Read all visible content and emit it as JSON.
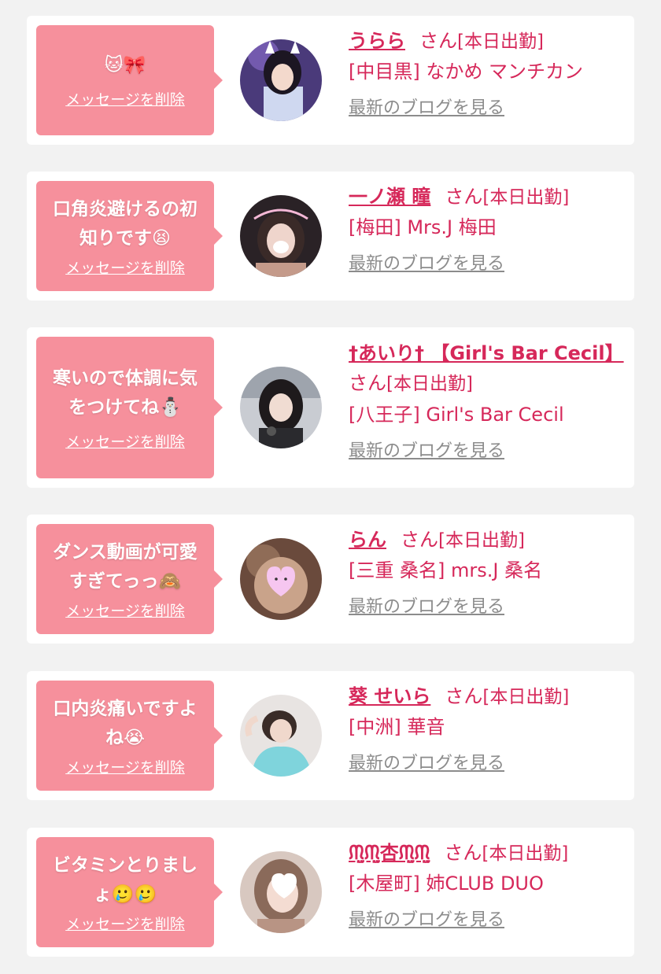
{
  "colors": {
    "accent": "#d6285a",
    "bubble": "#f6909c",
    "link_gray": "#8c8c8c",
    "background": "#f2f2f2"
  },
  "entries": [
    {
      "message": "🐱🎀",
      "delete_label": "メッセージを削除",
      "name": "うらら",
      "honorific": "さん",
      "status": "[本日出勤]",
      "shop": "[中目黒] なかめ マンチカン",
      "blog_link": "最新のブログを見る"
    },
    {
      "message": "口角炎避けるの初知りです😫",
      "delete_label": "メッセージを削除",
      "name": "一ノ瀬 瞳",
      "honorific": "さん",
      "status": "[本日出勤]",
      "shop": "[梅田] Mrs.J 梅田",
      "blog_link": "最新のブログを見る"
    },
    {
      "message": "寒いので体調に気をつけてね⛄",
      "delete_label": "メッセージを削除",
      "name": "†あいり† 【Girl's Bar Cecil】",
      "honorific": "さん",
      "status": "[本日出勤]",
      "shop": "[八王子] Girl's Bar Cecil",
      "blog_link": "最新のブログを見る"
    },
    {
      "message": "ダンス動画が可愛すぎてっっ🙈",
      "delete_label": "メッセージを削除",
      "name": "らん",
      "honorific": "さん",
      "status": "[本日出勤]",
      "shop": "[三重 桑名] mrs.J 桑名",
      "blog_link": "最新のブログを見る"
    },
    {
      "message": "口内炎痛いですよね😭",
      "delete_label": "メッセージを削除",
      "name": "葵 せいら",
      "honorific": "さん",
      "status": "[本日出勤]",
      "shop": "[中洲] 華音",
      "blog_link": "最新のブログを見る"
    },
    {
      "message": "ビタミンとりましょ🥲🥲",
      "delete_label": "メッセージを削除",
      "name": "ᙏ̤̫ᙏ̤̫杏ᙏ̤̫ᙏ̤̫",
      "honorific": "さん",
      "status": "[本日出勤]",
      "shop": "[木屋町] 姉CLUB DUO",
      "blog_link": "最新のブログを見る"
    }
  ]
}
